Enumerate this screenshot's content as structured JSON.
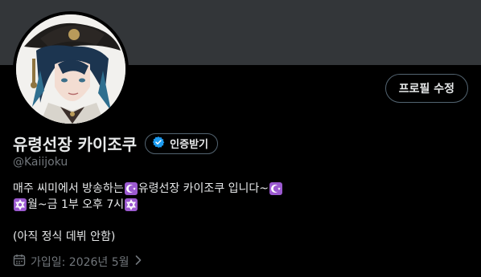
{
  "profile": {
    "display_name": "유령선장 카이조쿠",
    "handle": "@Kaiijoku",
    "edit_button_label": "프로필 수정",
    "verify_button_label": "인증받기"
  },
  "bio": {
    "line1_text": "매주 씨미에서 방송하는 ",
    "line1_name": "유령선장 카이조쿠 입니다~",
    "line2_text": "월~금 1부 오후 7시",
    "line3_text": "(아직 정식 데뷔 안함)"
  },
  "joined": {
    "text": "가입일: 2026년 5월"
  },
  "colors": {
    "background": "#000000",
    "banner": "#333639",
    "verified_badge": "#1d9bf0",
    "emoji_purple": "#9b59d0",
    "muted_text": "#71767b"
  },
  "icons": {
    "verified": "verified-badge-icon",
    "calendar": "calendar-icon",
    "chevron": "chevron-right-icon",
    "moon": "star-and-crescent-emoji",
    "star": "star-of-david-emoji"
  }
}
